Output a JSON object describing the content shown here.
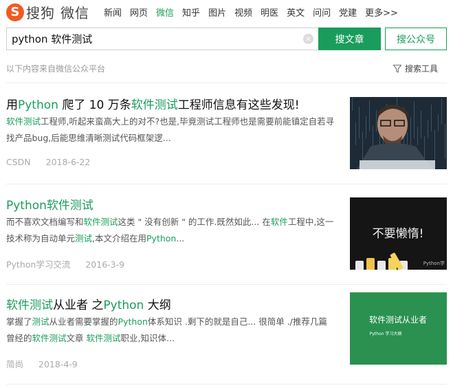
{
  "brand": {
    "logo_letter": "S",
    "name": "搜狗",
    "product": "微信"
  },
  "nav": [
    {
      "label": "新闻",
      "active": false
    },
    {
      "label": "网页",
      "active": false
    },
    {
      "label": "微信",
      "active": true
    },
    {
      "label": "知乎",
      "active": false
    },
    {
      "label": "图片",
      "active": false
    },
    {
      "label": "视频",
      "active": false
    },
    {
      "label": "明医",
      "active": false
    },
    {
      "label": "英文",
      "active": false
    },
    {
      "label": "问问",
      "active": false
    },
    {
      "label": "党建",
      "active": false
    },
    {
      "label": "更多>>",
      "active": false
    }
  ],
  "search": {
    "value": "python 软件测试",
    "clear_glyph": "×",
    "article_button": "搜文章",
    "account_button": "搜公众号"
  },
  "source_note": "以下内容来自微信公众平台",
  "tools_label": "搜索工具",
  "results": [
    {
      "title": [
        {
          "t": "用",
          "hl": false
        },
        {
          "t": "Python",
          "hl": true
        },
        {
          "t": " 爬了 10 万条",
          "hl": false
        },
        {
          "t": "软件测试",
          "hl": true
        },
        {
          "t": "工程师信息有这些发现!",
          "hl": false
        }
      ],
      "desc": [
        {
          "t": "软件测试",
          "hl": true
        },
        {
          "t": "工程师,听起来蛮高大上的对不?也是,毕竟测试工程师也是需要前能镇定自若寻找产品bug,后能思维清晰测试代码框架逻...",
          "hl": false
        }
      ],
      "source": "CSDN",
      "date": "2018-6-22",
      "thumb": {
        "kind": "photo"
      }
    },
    {
      "title": [
        {
          "t": "Python软件测试",
          "hl": true
        }
      ],
      "desc": [
        {
          "t": "而不喜欢文档编写和",
          "hl": false
        },
        {
          "t": "软件测试",
          "hl": true
        },
        {
          "t": "这类 \" 没有创新 \" 的工作.既然如此... 在",
          "hl": false
        },
        {
          "t": "软件",
          "hl": true
        },
        {
          "t": "工程中,这一技术称为自动单元",
          "hl": false
        },
        {
          "t": "测试",
          "hl": true
        },
        {
          "t": ",本文介绍在用",
          "hl": false
        },
        {
          "t": "Python",
          "hl": true
        },
        {
          "t": "...",
          "hl": false
        }
      ],
      "source": "Python学习交流",
      "date": "2016-3-9",
      "thumb": {
        "kind": "chalkboard",
        "big_text": "不要懒惰!",
        "watermark": "Python学"
      }
    },
    {
      "title": [
        {
          "t": "软件测试",
          "hl": true
        },
        {
          "t": "从业者 之",
          "hl": false
        },
        {
          "t": "Python",
          "hl": true
        },
        {
          "t": " 大纲",
          "hl": false
        }
      ],
      "desc": [
        {
          "t": "掌握了",
          "hl": false
        },
        {
          "t": "测试",
          "hl": true
        },
        {
          "t": "从业者需要掌握的",
          "hl": false
        },
        {
          "t": "Python",
          "hl": true
        },
        {
          "t": "体系知识 .剩下的就是自己... 很简单 ./推荐几篇曾经的",
          "hl": false
        },
        {
          "t": "软件测试",
          "hl": true
        },
        {
          "t": "文章  ",
          "hl": false
        },
        {
          "t": "软件测试",
          "hl": true
        },
        {
          "t": "职业,知识体...",
          "hl": false
        }
      ],
      "source": "简尚",
      "date": "2018-4-9",
      "thumb": {
        "kind": "green",
        "big_text": "软件测试从业者",
        "small_text": "Python 学习大纲",
        "bg": "#2a9150"
      }
    }
  ],
  "colors": {
    "accent": "#1a9d5c",
    "logo": "#f05a22"
  }
}
